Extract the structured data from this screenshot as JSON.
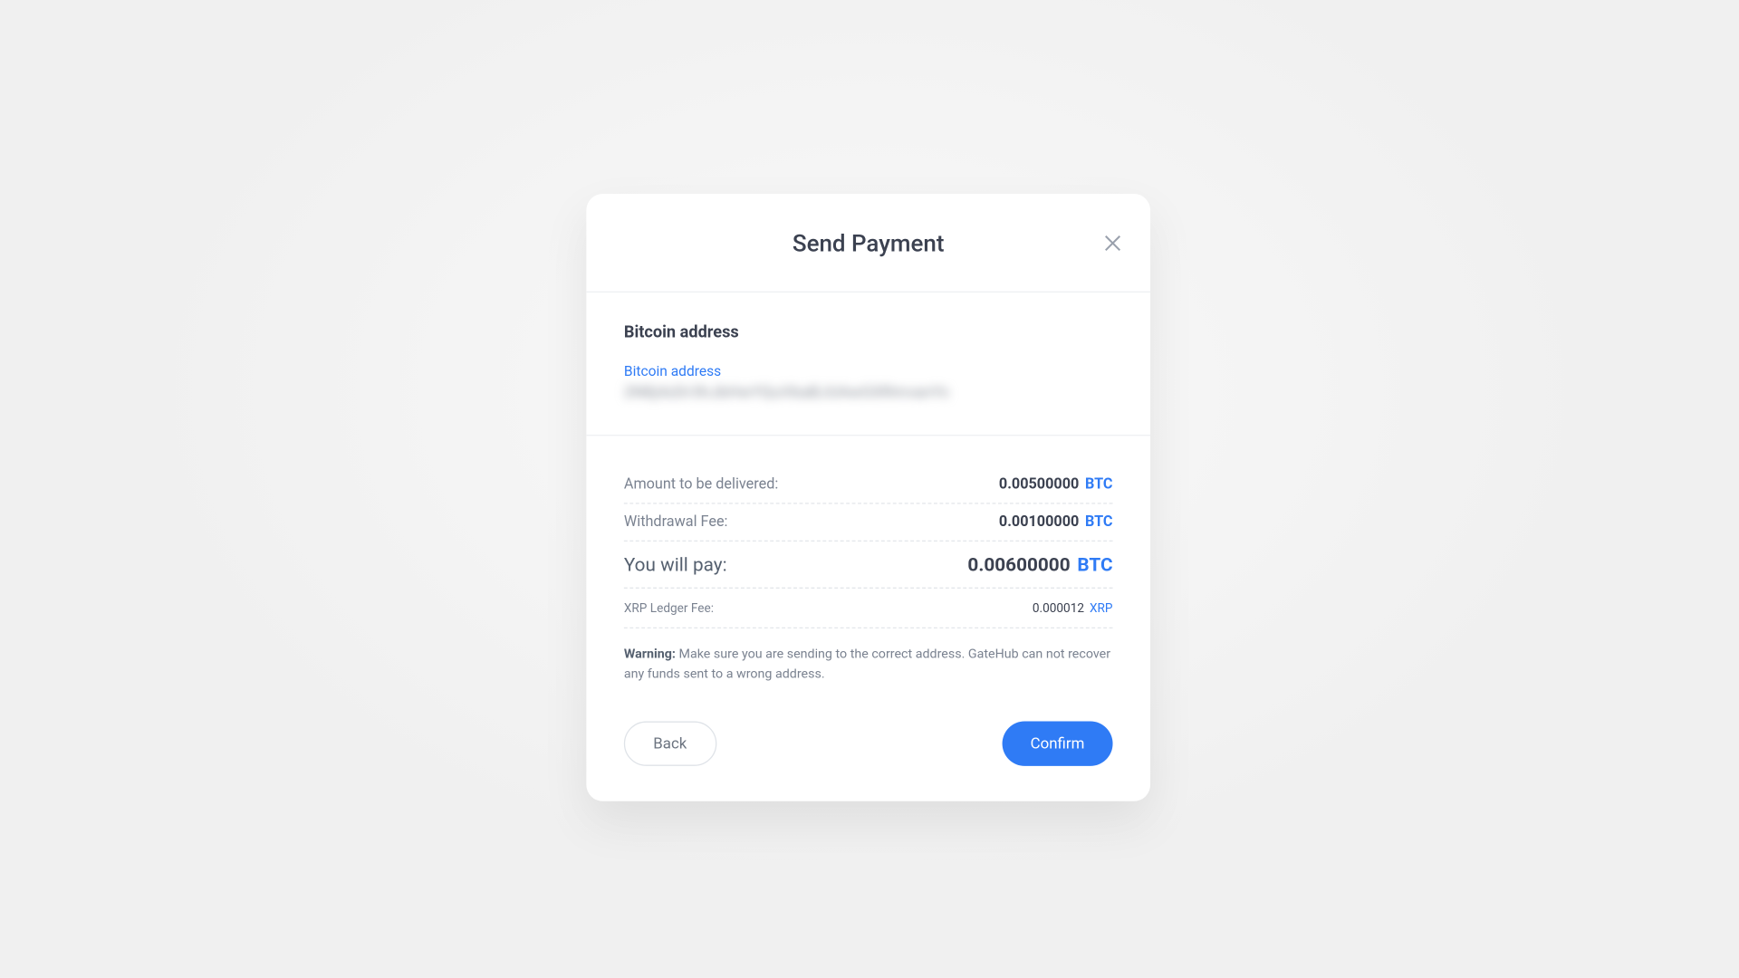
{
  "modal": {
    "title": "Send Payment",
    "address_section": {
      "heading": "Bitcoin address",
      "field_label": "Bitcoin address",
      "value_obscured": "2N8j4zDr3hJbHwYQuVbaBJUAwGXRmvanYc"
    },
    "rows": {
      "amount": {
        "label": "Amount to be delivered:",
        "value": "0.00500000",
        "currency": "BTC"
      },
      "fee": {
        "label": "Withdrawal Fee:",
        "value": "0.00100000",
        "currency": "BTC"
      },
      "total": {
        "label": "You will pay:",
        "value": "0.00600000",
        "currency": "BTC"
      },
      "ledger": {
        "label": "XRP Ledger Fee:",
        "value": "0.000012",
        "currency": "XRP"
      }
    },
    "warning": {
      "label": "Warning:",
      "text": "Make sure you are sending to the correct address. GateHub can not recover any funds sent to a wrong address."
    },
    "buttons": {
      "back": "Back",
      "confirm": "Confirm"
    }
  }
}
